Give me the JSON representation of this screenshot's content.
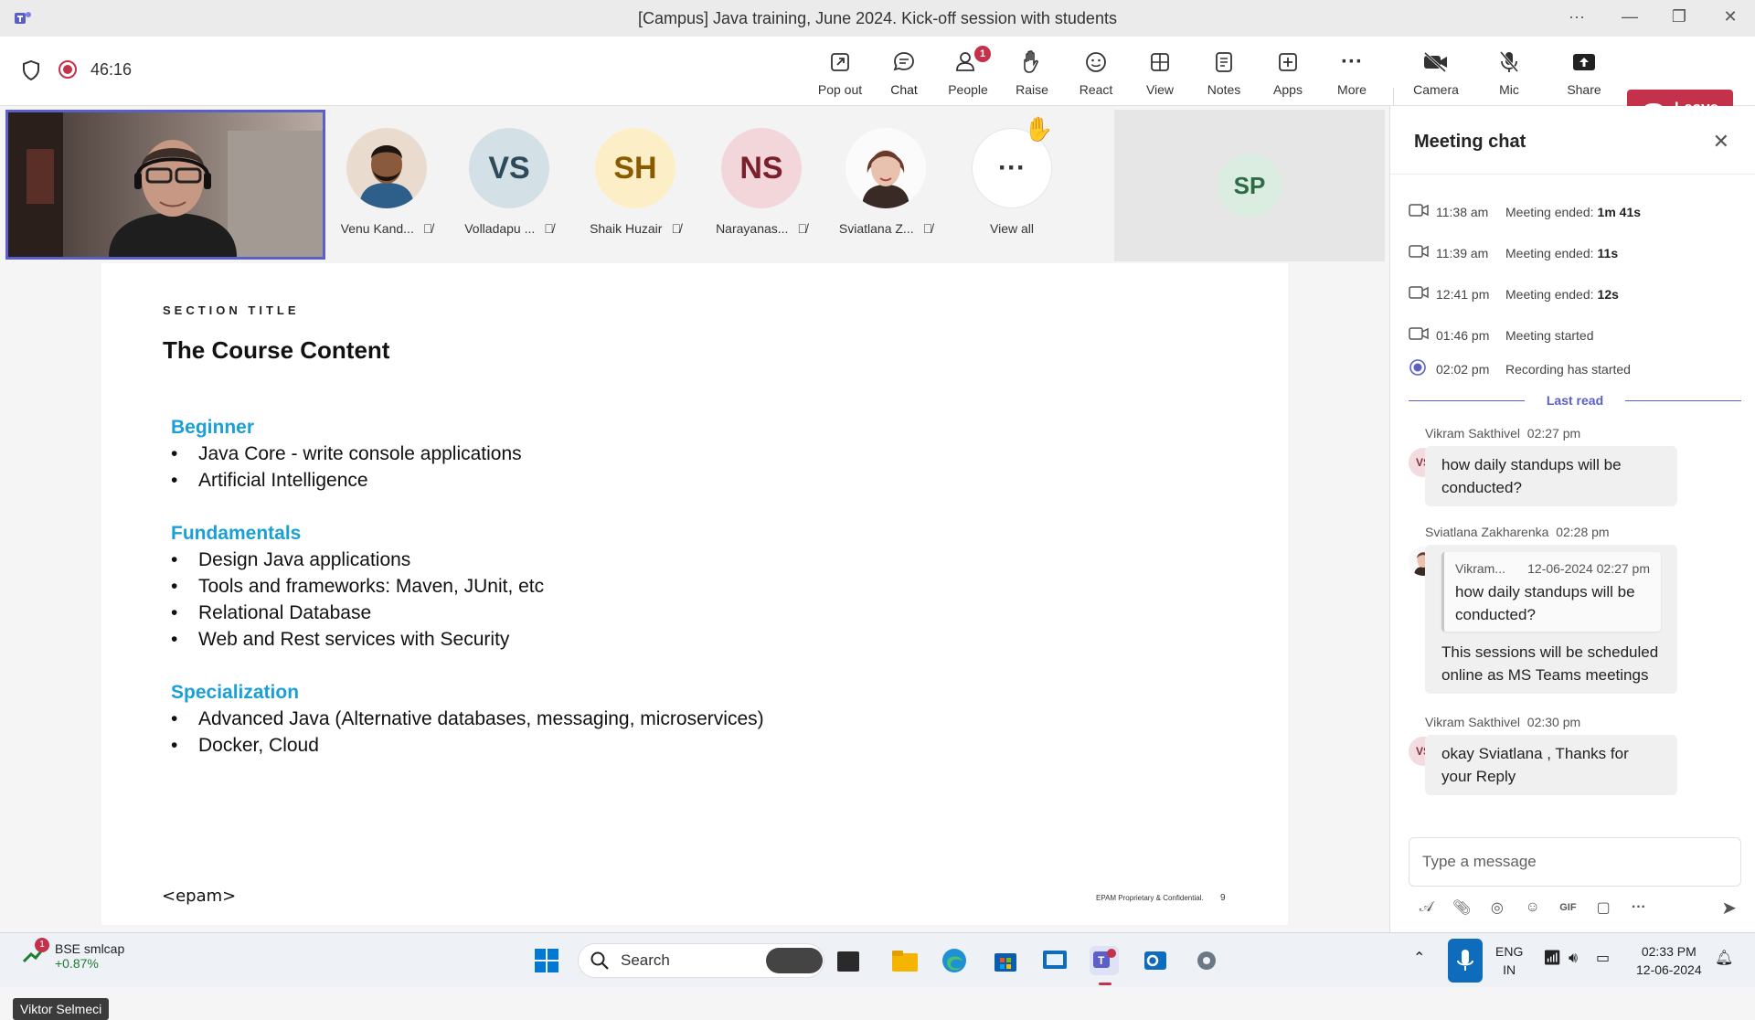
{
  "window": {
    "title": "[Campus] Java training, June 2024. Kick-off session with students"
  },
  "meeting_toolbar": {
    "timer": "46:16",
    "buttons": {
      "pop_out": "Pop out",
      "chat": "Chat",
      "people": "People",
      "people_badge": "1",
      "raise": "Raise",
      "react": "React",
      "view": "View",
      "notes": "Notes",
      "apps": "Apps",
      "more": "More",
      "camera": "Camera",
      "mic": "Mic",
      "share": "Share",
      "leave": "Leave"
    },
    "colors": {
      "accent": "#5b5fc7",
      "leave": "#c4314b"
    }
  },
  "participants": [
    {
      "name": "Venu Kand...",
      "initials": "",
      "avatar_type": "photo"
    },
    {
      "name": "Volladapu ...",
      "initials": "VS",
      "avatar_color": "#d3e0e6"
    },
    {
      "name": "Shaik Huzair",
      "initials": "SH",
      "avatar_color": "#fcefc7"
    },
    {
      "name": "Narayanas...",
      "initials": "NS",
      "avatar_color": "#f2d6d9"
    },
    {
      "name": "Sviatlana Z...",
      "initials": "",
      "avatar_type": "photo"
    }
  ],
  "view_all": {
    "label": "View all"
  },
  "spotlight_tile": {
    "initials": "SP"
  },
  "presenter_tag": "Viktor Selmeci",
  "slide": {
    "section_title": "SECTION TITLE",
    "title": "The Course Content",
    "groups": [
      {
        "heading": "Beginner",
        "items": [
          "Java Core - write console applications",
          "Artificial Intelligence"
        ]
      },
      {
        "heading": "Fundamentals",
        "items": [
          "Design Java applications",
          "Tools and frameworks: Maven, JUnit, etc",
          "Relational Database",
          "Web and Rest services with Security"
        ]
      },
      {
        "heading": "Specialization",
        "items": [
          "Advanced Java (Alternative databases, messaging, microservices)",
          "Docker, Cloud"
        ]
      }
    ],
    "logo": "<epam>",
    "footer_note": "EPAM Proprietary & Confidential.",
    "page_number": "9"
  },
  "chat": {
    "title": "Meeting chat",
    "system_events": [
      {
        "time": "11:38 am",
        "text": "Meeting ended:",
        "bold": "1m 41s",
        "icon": "camera-icon"
      },
      {
        "time": "11:39 am",
        "text": "Meeting ended:",
        "bold": "11s",
        "icon": "camera-icon"
      },
      {
        "time": "12:41 pm",
        "text": "Meeting ended:",
        "bold": "12s",
        "icon": "camera-icon"
      },
      {
        "time": "01:46 pm",
        "text": "Meeting started",
        "bold": "",
        "icon": "camera-icon"
      },
      {
        "time": "02:02 pm",
        "text": "Recording has started",
        "bold": "",
        "icon": "record-icon"
      }
    ],
    "last_read": "Last read",
    "messages": [
      {
        "sender": "Vikram Sakthivel",
        "time": "02:27 pm",
        "initials": "VS",
        "text": "how daily standups will be conducted?"
      },
      {
        "sender": "Sviatlana Zakharenka",
        "time": "02:28 pm",
        "quote_sender": "Vikram...",
        "quote_time": "12-06-2024 02:27 pm",
        "quote_text": "how daily standups will be conducted?",
        "text": "This sessions will be scheduled online as MS Teams meetings"
      },
      {
        "sender": "Vikram Sakthivel",
        "time": "02:30 pm",
        "initials": "VS",
        "text": "okay Sviatlana , Thanks for your Reply"
      }
    ],
    "composer_placeholder": "Type a message"
  },
  "taskbar": {
    "stock_badge": "1",
    "stock_name": "BSE smlcap",
    "stock_change": "+0.87%",
    "search_label": "Search",
    "language": "ENG",
    "region": "IN",
    "time": "02:33 PM",
    "date": "12-06-2024"
  }
}
